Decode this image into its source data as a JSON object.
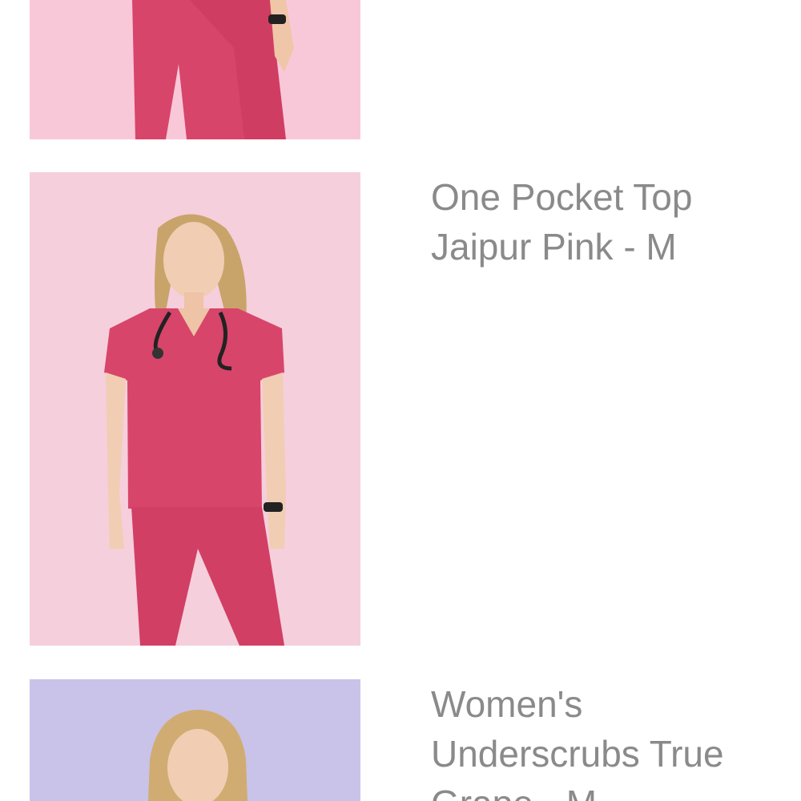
{
  "products": [
    {
      "title": "",
      "image_alt": "model in pink scrub pants",
      "bg_color": "#f9c8d8",
      "garment_color": "#d8456a"
    },
    {
      "title": "One Pocket Top Jaipur Pink - M",
      "image_alt": "model in Jaipur Pink one pocket scrub top with stethoscope",
      "bg_color": "#f5cfdc",
      "garment_color": "#d8456a"
    },
    {
      "title": "Women's Underscrubs True Grape - M",
      "image_alt": "model in True Grape underscrubs",
      "bg_color": "#c9c3e9",
      "garment_color": "#6b4f9a"
    }
  ]
}
